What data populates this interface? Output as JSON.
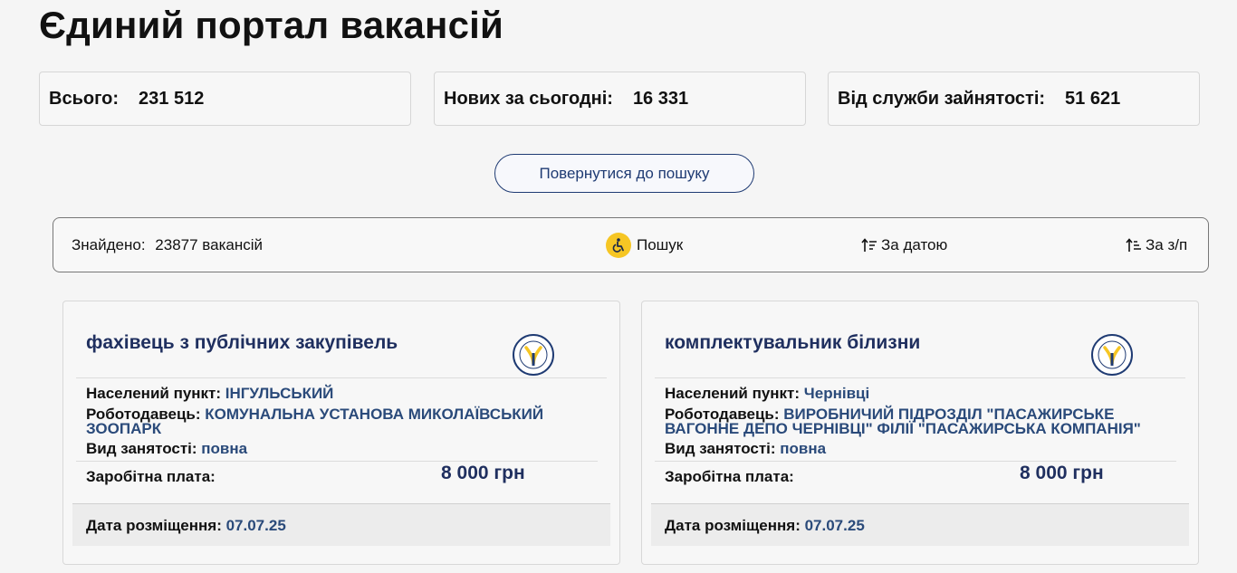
{
  "page": {
    "title": "Єдиний портал вакансій"
  },
  "stats": [
    {
      "label": "Всього:",
      "value": "231 512"
    },
    {
      "label": "Нових за сьогодні:",
      "value": "16 331"
    },
    {
      "label": "Від служби зайнятості:",
      "value": "51 621"
    }
  ],
  "back_button": {
    "label": "Повернутися до пошуку"
  },
  "toolbar": {
    "found_label": "Знайдено:",
    "found_value": "23877 вакансій",
    "search_label": "Пошук",
    "sort_date_label": "За датою",
    "sort_salary_label": "За з/п"
  },
  "vacancies": [
    {
      "title": "фахівець з публічних закупівель",
      "logo_text": "Державна служба зайнятості",
      "location_label": "Населений пункт:",
      "location": "ІНГУЛЬСЬКИЙ",
      "employer_label": "Роботодавець:",
      "employer": "КОМУНАЛЬНА УСТАНОВА МИКОЛАЇВСЬКИЙ ЗООПАРК",
      "employment_label": "Вид занятості:",
      "employment": "повна",
      "salary_label": "Заробітна плата:",
      "salary": "8 000 грн",
      "date_label": "Дата розміщення:",
      "date": "07.07.25"
    },
    {
      "title": "комплектувальник білизни",
      "logo_text": "Державна служба зайнятості",
      "location_label": "Населений пункт:",
      "location": "Чернівці",
      "employer_label": "Роботодавець:",
      "employer": "ВИРОБНИЧИЙ ПІДРОЗДІЛ \"ПАСАЖИРСЬКЕ ВАГОННЕ ДЕПО ЧЕРНІВЦІ\" ФІЛІЇ \"ПАСАЖИРСЬКА КОМПАНІЯ\"",
      "employment_label": "Вид занятості:",
      "employment": "повна",
      "salary_label": "Заробітна плата:",
      "salary": "8 000 грн",
      "date_label": "Дата розміщення:",
      "date": "07.07.25"
    }
  ],
  "colors": {
    "accent": "#1f3b73",
    "value": "#2a4a7a",
    "badge": "#f6c624"
  }
}
